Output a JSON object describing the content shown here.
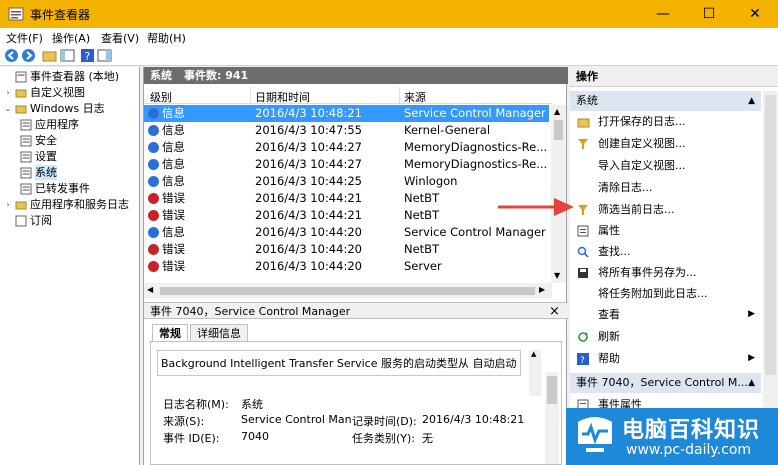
{
  "window": {
    "title": "事件查看器",
    "minimize": "—",
    "maximize": "☐",
    "close": "✕"
  },
  "menu": [
    "文件(F)",
    "操作(A)",
    "查看(V)",
    "帮助(H)"
  ],
  "tree": {
    "root": "事件查看器 (本地)",
    "custom_views": "自定义视图",
    "windows_logs": "Windows 日志",
    "app": "应用程序",
    "security": "安全",
    "setup": "设置",
    "system": "系统",
    "forwarded": "已转发事件",
    "apps_services": "应用程序和服务日志",
    "subscriptions": "订阅"
  },
  "center": {
    "header_name": "系统",
    "header_count": "事件数: 941",
    "columns": [
      "级别",
      "日期和时间",
      "来源"
    ],
    "rows": [
      {
        "level": "信息",
        "type": "info",
        "date": "2016/4/3 10:48:21",
        "source": "Service Control Manager"
      },
      {
        "level": "信息",
        "type": "info",
        "date": "2016/4/3 10:47:55",
        "source": "Kernel-General"
      },
      {
        "level": "信息",
        "type": "info",
        "date": "2016/4/3 10:44:27",
        "source": "MemoryDiagnostics-Re..."
      },
      {
        "level": "信息",
        "type": "info",
        "date": "2016/4/3 10:44:27",
        "source": "MemoryDiagnostics-Re..."
      },
      {
        "level": "信息",
        "type": "info",
        "date": "2016/4/3 10:44:25",
        "source": "Winlogon"
      },
      {
        "level": "错误",
        "type": "error",
        "date": "2016/4/3 10:44:21",
        "source": "NetBT"
      },
      {
        "level": "错误",
        "type": "error",
        "date": "2016/4/3 10:44:21",
        "source": "NetBT"
      },
      {
        "level": "信息",
        "type": "info",
        "date": "2016/4/3 10:44:20",
        "source": "Service Control Manager"
      },
      {
        "level": "错误",
        "type": "error",
        "date": "2016/4/3 10:44:20",
        "source": "NetBT"
      },
      {
        "level": "错误",
        "type": "error",
        "date": "2016/4/3 10:44:20",
        "source": "Server"
      }
    ],
    "detail_header": "事件 7040，Service Control Manager",
    "detail_close": "×",
    "tab_general": "常规",
    "tab_details": "详细信息",
    "description": "Background Intelligent Transfer Service 服务的启动类型从 自动启动 更",
    "log_name_label": "日志名称(M):",
    "log_name_value": "系统",
    "source_label": "来源(S):",
    "source_value": "Service Control Man",
    "logged_label": "记录时间(D):",
    "logged_value": "2016/4/3 10:48:21",
    "event_id_label": "事件 ID(E):",
    "event_id_value": "7040",
    "task_label": "任务类别(Y):",
    "task_value": "无"
  },
  "actions": {
    "title": "操作",
    "group1": "系统",
    "items": [
      {
        "label": "打开保存的日志...",
        "icon": "folder-open-icon"
      },
      {
        "label": "创建自定义视图...",
        "icon": "filter-icon"
      },
      {
        "label": "导入自定义视图...",
        "icon": ""
      },
      {
        "label": "清除日志...",
        "icon": ""
      },
      {
        "label": "筛选当前日志...",
        "icon": "filter-icon"
      },
      {
        "label": "属性",
        "icon": "properties-icon"
      },
      {
        "label": "查找...",
        "icon": "find-icon"
      },
      {
        "label": "将所有事件另存为...",
        "icon": "save-icon"
      },
      {
        "label": "将任务附加到此日志...",
        "icon": ""
      },
      {
        "label": "查看",
        "icon": ""
      },
      {
        "label": "刷新",
        "icon": "refresh-icon"
      },
      {
        "label": "帮助",
        "icon": "help-icon"
      }
    ],
    "group2": "事件 7040，Service Control M...",
    "event_props": "事件属性"
  },
  "watermark": {
    "title": "电脑百科知识",
    "url": "www.pc-daily.com"
  },
  "colors": {
    "titlebar": "#f5b301",
    "selection": "#3399ff",
    "arrow": "#e0443a",
    "watermark": "#1e88d9"
  }
}
